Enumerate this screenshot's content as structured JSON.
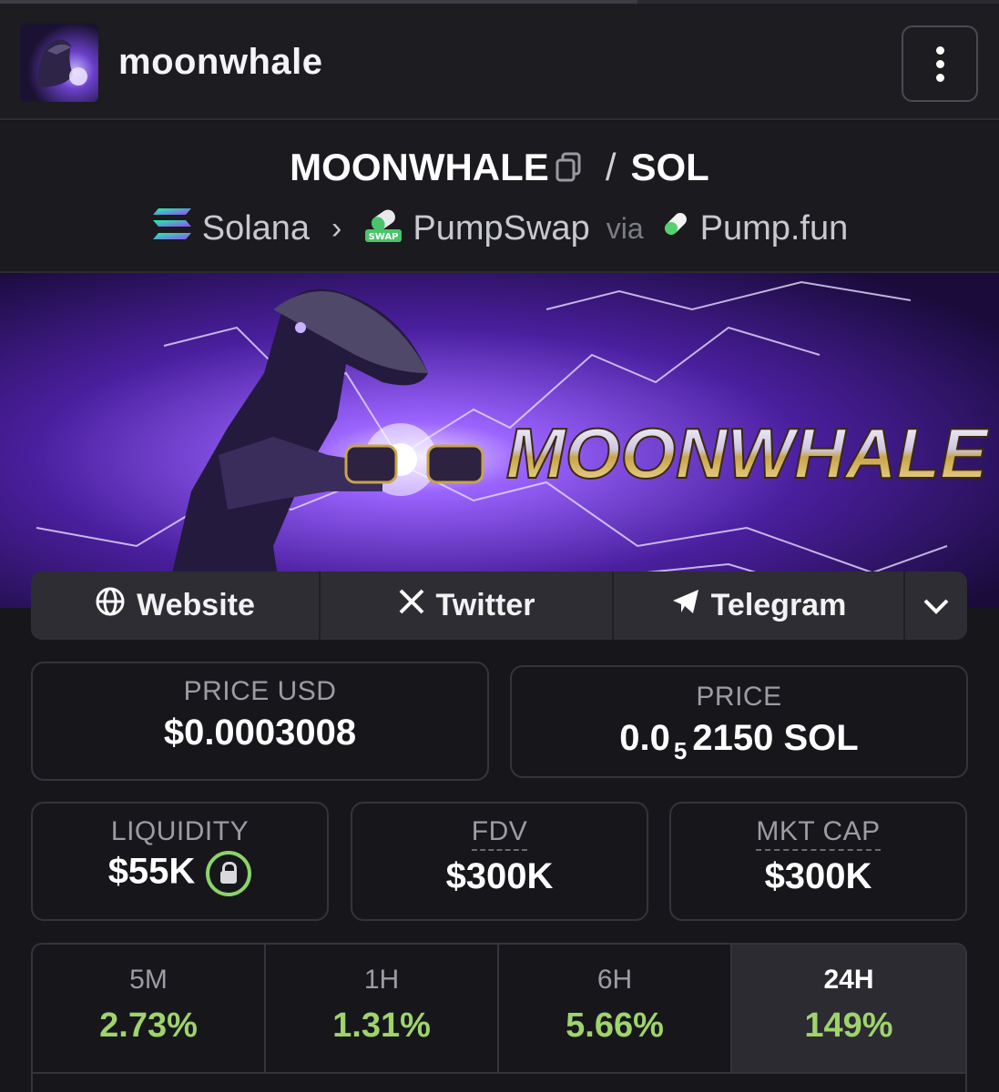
{
  "header": {
    "token_name": "moonwhale",
    "avatar_icon": "moonwhale-avatar",
    "menu_icon": "vertical-dots-icon"
  },
  "pair": {
    "base": "MOONWHALE",
    "slash": "/",
    "quote": "SOL",
    "chain": "Solana",
    "dex": "PumpSwap",
    "via": "via",
    "launchpad": "Pump.fun"
  },
  "banner": {
    "title": "MOONWHALE"
  },
  "links": {
    "website": "Website",
    "twitter": "Twitter",
    "telegram": "Telegram"
  },
  "stats": {
    "price_usd_label": "PRICE USD",
    "price_usd_value": "$0.0003008",
    "price_label": "PRICE",
    "price_prefix": "0.0",
    "price_zeros": "5",
    "price_suffix": "2150 SOL",
    "liquidity_label": "LIQUIDITY",
    "liquidity_value": "$55K",
    "fdv_label": "FDV",
    "fdv_value": "$300K",
    "mktcap_label": "MKT CAP",
    "mktcap_value": "$300K"
  },
  "changes": [
    {
      "period": "5M",
      "value": "2.73%"
    },
    {
      "period": "1H",
      "value": "1.31%"
    },
    {
      "period": "6H",
      "value": "5.66%"
    },
    {
      "period": "24H",
      "value": "149%"
    }
  ],
  "colors": {
    "positive": "#9fd36d",
    "lock_ring": "#8cd36b",
    "background": "#17171b"
  }
}
